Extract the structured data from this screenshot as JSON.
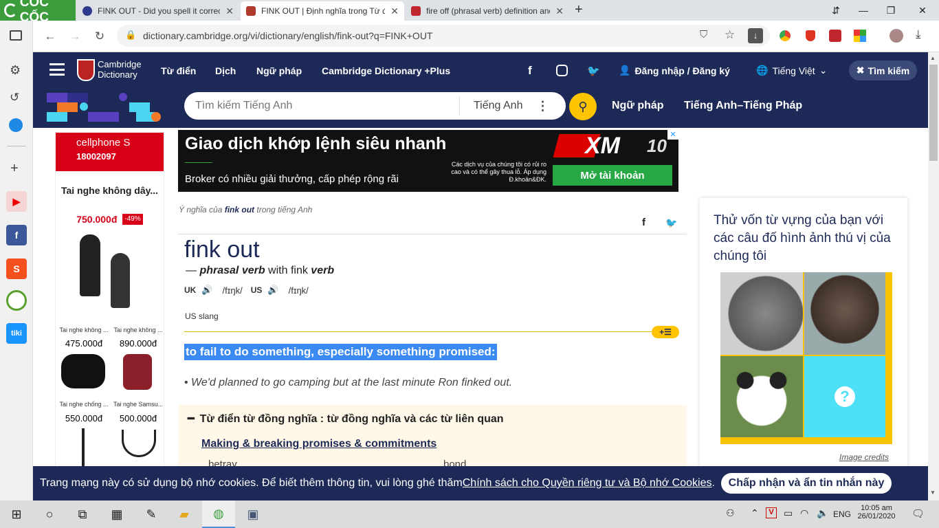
{
  "browser": {
    "brand": "CỐC CỐC",
    "tabs": [
      {
        "title": "FINK OUT - Did you spell it correctly?",
        "active": false
      },
      {
        "title": "FINK OUT | Định nghĩa trong Từ điển",
        "active": true
      },
      {
        "title": "fire off (phrasal verb) definition and synonyms",
        "active": false
      }
    ],
    "url": "dictionary.cambridge.org/vi/dictionary/english/fink-out?q=FINK+OUT"
  },
  "site": {
    "logo_line1": "Cambridge",
    "logo_line2": "Dictionary",
    "nav": [
      "Từ điển",
      "Dịch",
      "Ngữ pháp",
      "Cambridge Dictionary +Plus"
    ],
    "login": "Đăng nhập / Đăng ký",
    "language": "Tiếng Việt",
    "search_btn": "Tìm kiếm",
    "search_placeholder": "Tìm kiếm Tiếng Anh",
    "search_lang": "Tiếng Anh",
    "links": [
      "Ngữ pháp",
      "Tiếng Anh–Tiếng Pháp"
    ]
  },
  "left_ad": {
    "brand": "cellphone S",
    "phone": "18002097",
    "title": "Tai nghe không dây...",
    "price_main": "750.000đ",
    "discount": "-49%",
    "products": [
      {
        "name": "Tai nghe không ...",
        "price": "475.000đ"
      },
      {
        "name": "Tai nghe không ...",
        "price": "890.000đ"
      },
      {
        "name": "Tai nghe chống ...",
        "price": "550.000đ"
      },
      {
        "name": "Tai nghe Samsu...",
        "price": "500.000đ"
      }
    ]
  },
  "top_ad": {
    "headline": "Giao dịch khớp lệnh siêu nhanh",
    "sub": "Broker có nhiều giải thưởng, cấp phép rộng rãi",
    "risk": "Các dịch vụ của chúng tôi có rủi ro cao và có thể gây thua lỗ. Áp dụng Đ.khoản&ĐK.",
    "brand": "XM",
    "cta": "Mở tài khoản"
  },
  "entry": {
    "crumb_pre": "Ý nghĩa của ",
    "crumb_word": "fink out",
    "crumb_post": " trong tiếng Anh",
    "headword": "fink out",
    "pos_dash": "— ",
    "pos": "phrasal verb",
    "pos_with": " with fink ",
    "pos_verb": "verb",
    "uk": "UK",
    "uk_ipa": "/fɪŋk/",
    "us": "US",
    "us_ipa": "/fɪŋk/",
    "register": "US slang",
    "definition": "to fail to do something, especially something promised:",
    "example": "We'd planned to go camping but at the last minute Ron finked out."
  },
  "thesaurus": {
    "heading": "Từ điển từ đồng nghĩa : từ đồng nghĩa và các từ liên quan",
    "topic": "Making & breaking promises & commitments",
    "words": [
      "betray",
      "bond"
    ]
  },
  "quiz": {
    "text": "Thử vốn từ vựng của bạn với các câu đố hình ảnh thú vị của chúng tôi",
    "credits": "Image credits"
  },
  "cookie": {
    "text": "Trang mạng này có sử dụng bộ nhớ cookies. Để biết thêm thông tin, vui lòng ghé thăm ",
    "link": "Chính sách cho Quyền riêng tư và Bộ nhớ Cookies",
    "end": ".",
    "accept": "Chấp nhận và ẩn tin nhắn này"
  },
  "taskbar": {
    "lang": "ENG",
    "time": "10:05 am",
    "date": "26/01/2020"
  }
}
